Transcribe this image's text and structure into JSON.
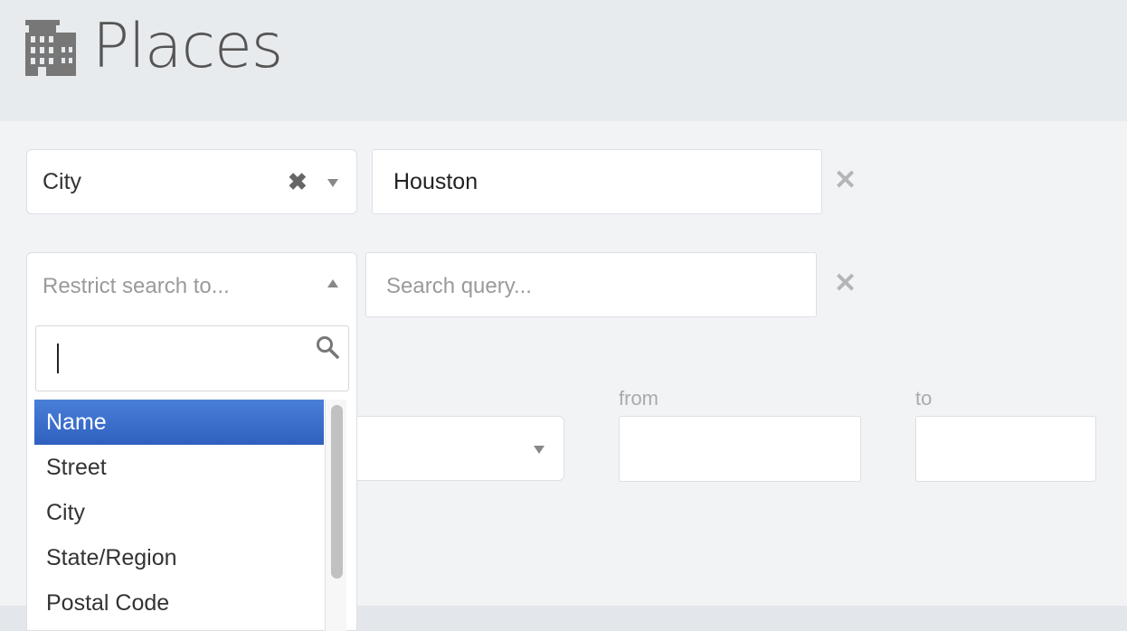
{
  "header": {
    "title": "Places",
    "icon": "building-icon"
  },
  "filters": [
    {
      "field": "City",
      "value": "Houston",
      "placeholder": "Search query..."
    },
    {
      "field": "",
      "field_placeholder": "Restrict search to...",
      "value": "",
      "placeholder": "Search query..."
    }
  ],
  "range": {
    "from_label": "from",
    "to_label": "to"
  },
  "dropdown": {
    "search_value": "",
    "options": [
      "Name",
      "Street",
      "City",
      "State/Region",
      "Postal Code"
    ],
    "highlighted": "Name"
  },
  "colors": {
    "highlight": "#3c6fd0",
    "background": "#f2f3f5",
    "header_bg": "#e8ebee"
  }
}
